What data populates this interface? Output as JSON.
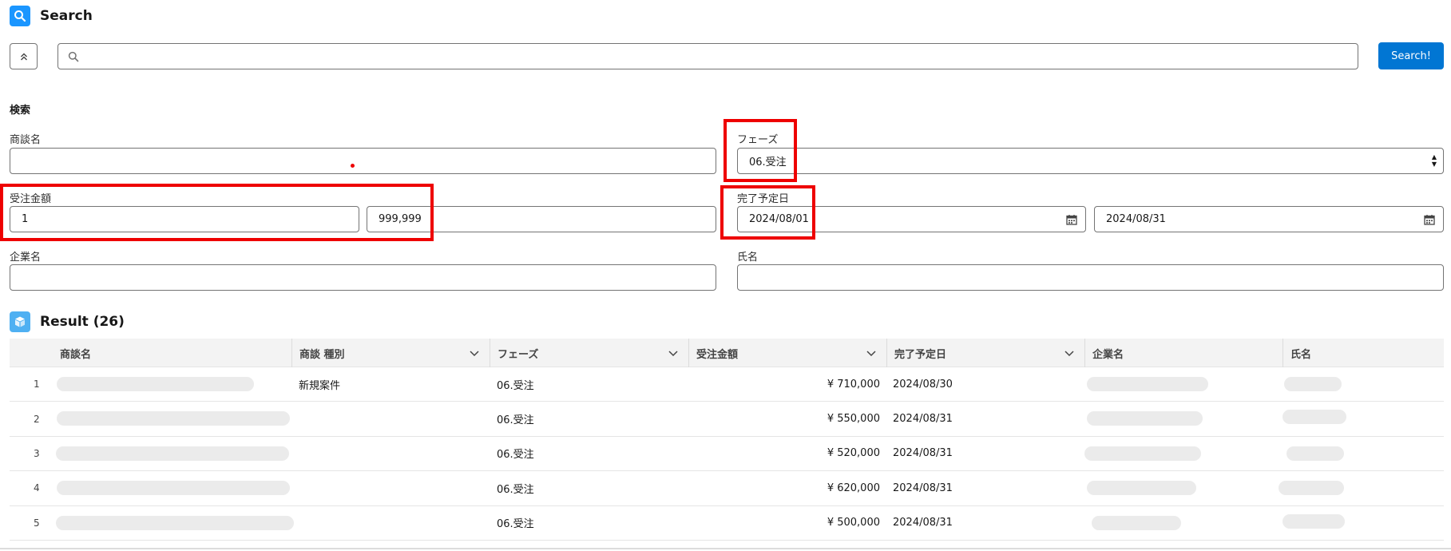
{
  "header": {
    "title": "Search",
    "icon": "search-icon"
  },
  "search": {
    "placeholder": "",
    "button_label": "Search!"
  },
  "filters": {
    "section_title": "検索",
    "deal_name": {
      "label": "商談名",
      "value": ""
    },
    "phase": {
      "label": "フェーズ",
      "value": "06.受注"
    },
    "amount": {
      "label": "受注金額",
      "min": "1",
      "max": "999,999"
    },
    "close_date": {
      "label": "完了予定日",
      "from": "2024/08/01",
      "to": "2024/08/31"
    },
    "company": {
      "label": "企業名",
      "value": ""
    },
    "person": {
      "label": "氏名",
      "value": ""
    }
  },
  "result": {
    "title": "Result (26)",
    "columns": [
      "商談名",
      "商談 種別",
      "フェーズ",
      "受注金額",
      "完了予定日",
      "企業名",
      "氏名"
    ],
    "rows": [
      {
        "num": "1",
        "type": "新規案件",
        "phase": "06.受注",
        "amount": "¥ 710,000",
        "date": "2024/08/30"
      },
      {
        "num": "2",
        "type": "",
        "phase": "06.受注",
        "amount": "¥ 550,000",
        "date": "2024/08/31"
      },
      {
        "num": "3",
        "type": "",
        "phase": "06.受注",
        "amount": "¥ 520,000",
        "date": "2024/08/31"
      },
      {
        "num": "4",
        "type": "",
        "phase": "06.受注",
        "amount": "¥ 620,000",
        "date": "2024/08/31"
      },
      {
        "num": "5",
        "type": "",
        "phase": "06.受注",
        "amount": "¥ 500,000",
        "date": "2024/08/31"
      }
    ]
  },
  "colors": {
    "brand": "#0176d3",
    "highlight": "#ee0000",
    "icon_blue": "#1b96ff"
  }
}
